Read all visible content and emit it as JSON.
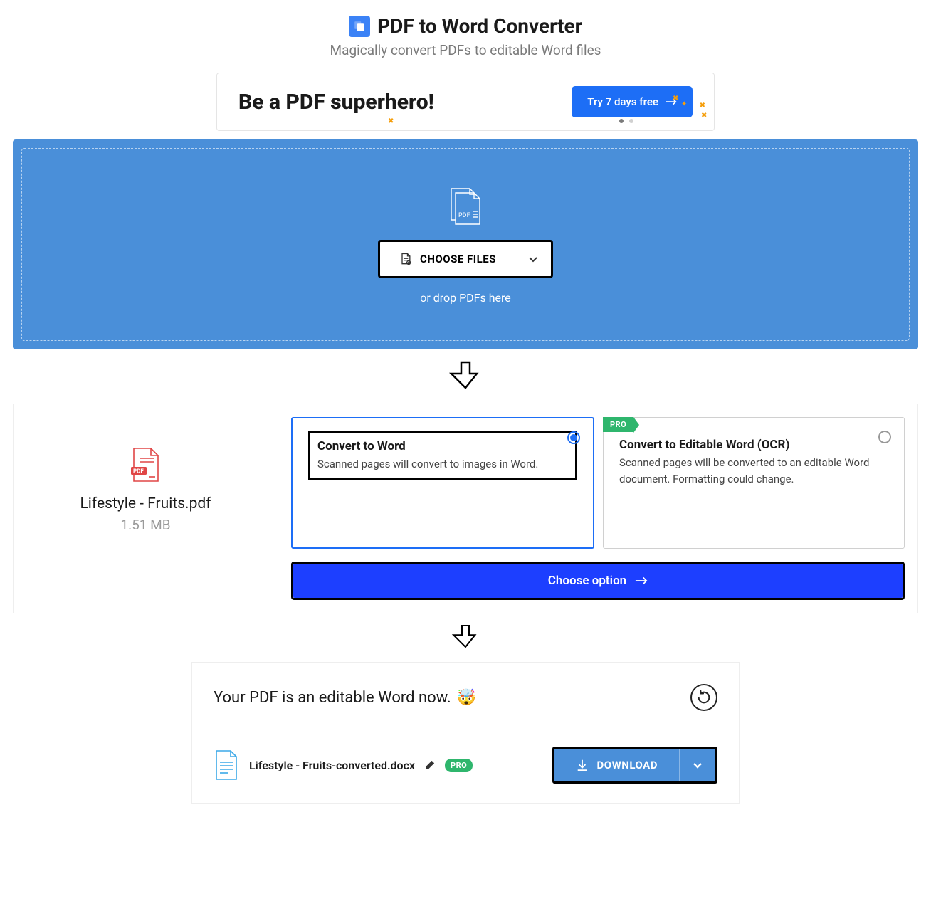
{
  "header": {
    "title": "PDF to Word Converter",
    "subtitle": "Magically convert PDFs to editable Word files"
  },
  "promo": {
    "headline": "Be a PDF superhero!",
    "cta": "Try 7 days free"
  },
  "dropzone": {
    "button": "CHOOSE FILES",
    "hint": "or drop PDFs here"
  },
  "file": {
    "name": "Lifestyle - Fruits.pdf",
    "size": "1.51 MB"
  },
  "options": {
    "basic": {
      "title": "Convert to Word",
      "desc": "Scanned pages will convert to images in Word."
    },
    "ocr": {
      "badge": "PRO",
      "title": "Convert to Editable Word (OCR)",
      "desc": "Scanned pages will be converted to an editable Word document. Formatting could change."
    },
    "cta": "Choose option"
  },
  "result": {
    "message": "Your PDF is an editable Word now.",
    "emoji": "🤯",
    "filename": "Lifestyle - Fruits-converted.docx",
    "pro": "PRO",
    "download": "DOWNLOAD"
  }
}
